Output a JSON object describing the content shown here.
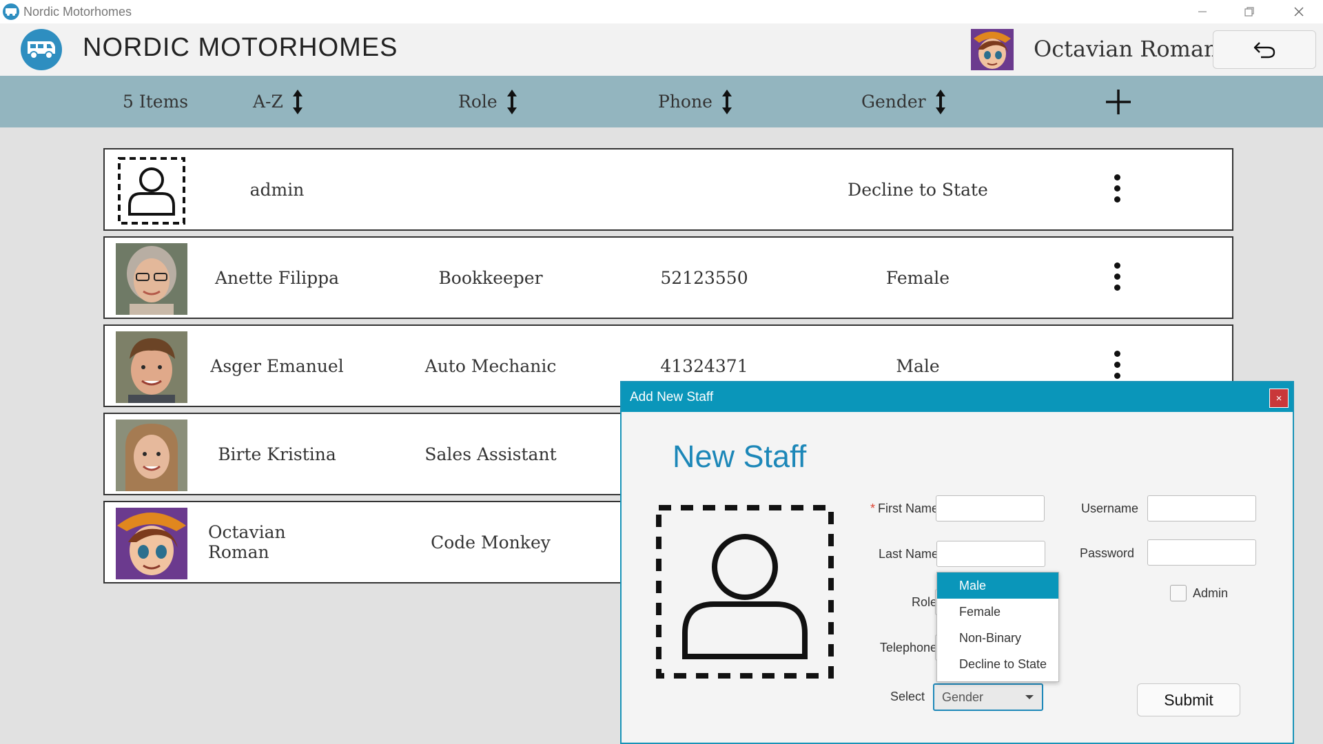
{
  "window": {
    "title": "Nordic Motorhomes"
  },
  "header": {
    "brand": "NORDIC MOTORHOMES",
    "user_name": "Octavian Roman"
  },
  "toolbar": {
    "count_label": "5 Items",
    "sort_az": "A-Z",
    "sort_role": "Role",
    "sort_phone": "Phone",
    "sort_gender": "Gender"
  },
  "staff": [
    {
      "name": "admin",
      "role": "",
      "phone": "",
      "gender": "Decline to State"
    },
    {
      "name": "Anette Filippa",
      "role": "Bookkeeper",
      "phone": "52123550",
      "gender": "Female"
    },
    {
      "name": "Asger Emanuel",
      "role": "Auto Mechanic",
      "phone": "41324371",
      "gender": "Male"
    },
    {
      "name": "Birte Kristina",
      "role": "Sales Assistant",
      "phone": "",
      "gender": ""
    },
    {
      "name": "Octavian Roman",
      "role": "Code Monkey",
      "phone": "",
      "gender": ""
    }
  ],
  "dialog": {
    "title": "Add New Staff",
    "close": "×",
    "heading": "New Staff",
    "first_name_label": "First Name",
    "required_mark": "*",
    "last_name_label": "Last Name",
    "role_label": "Role",
    "telephone_label": "Telephone",
    "select_label": "Select",
    "username_label": "Username",
    "password_label": "Password",
    "admin_label": "Admin",
    "gender_value": "Gender",
    "gender_options": [
      "Male",
      "Female",
      "Non-Binary",
      "Decline to State"
    ],
    "submit": "Submit"
  },
  "colors": {
    "accent": "#0a96ba",
    "toolbar": "#93b5bf",
    "close": "#c9383a"
  }
}
